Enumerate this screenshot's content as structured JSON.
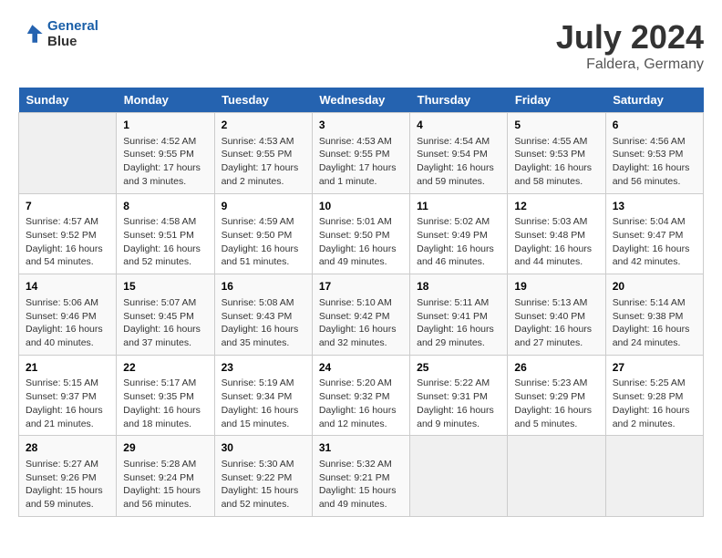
{
  "header": {
    "logo_line1": "General",
    "logo_line2": "Blue",
    "title": "July 2024",
    "subtitle": "Faldera, Germany"
  },
  "days_of_week": [
    "Sunday",
    "Monday",
    "Tuesday",
    "Wednesday",
    "Thursday",
    "Friday",
    "Saturday"
  ],
  "weeks": [
    [
      {
        "day": "",
        "info": ""
      },
      {
        "day": "1",
        "info": "Sunrise: 4:52 AM\nSunset: 9:55 PM\nDaylight: 17 hours\nand 3 minutes."
      },
      {
        "day": "2",
        "info": "Sunrise: 4:53 AM\nSunset: 9:55 PM\nDaylight: 17 hours\nand 2 minutes."
      },
      {
        "day": "3",
        "info": "Sunrise: 4:53 AM\nSunset: 9:55 PM\nDaylight: 17 hours\nand 1 minute."
      },
      {
        "day": "4",
        "info": "Sunrise: 4:54 AM\nSunset: 9:54 PM\nDaylight: 16 hours\nand 59 minutes."
      },
      {
        "day": "5",
        "info": "Sunrise: 4:55 AM\nSunset: 9:53 PM\nDaylight: 16 hours\nand 58 minutes."
      },
      {
        "day": "6",
        "info": "Sunrise: 4:56 AM\nSunset: 9:53 PM\nDaylight: 16 hours\nand 56 minutes."
      }
    ],
    [
      {
        "day": "7",
        "info": "Sunrise: 4:57 AM\nSunset: 9:52 PM\nDaylight: 16 hours\nand 54 minutes."
      },
      {
        "day": "8",
        "info": "Sunrise: 4:58 AM\nSunset: 9:51 PM\nDaylight: 16 hours\nand 52 minutes."
      },
      {
        "day": "9",
        "info": "Sunrise: 4:59 AM\nSunset: 9:50 PM\nDaylight: 16 hours\nand 51 minutes."
      },
      {
        "day": "10",
        "info": "Sunrise: 5:01 AM\nSunset: 9:50 PM\nDaylight: 16 hours\nand 49 minutes."
      },
      {
        "day": "11",
        "info": "Sunrise: 5:02 AM\nSunset: 9:49 PM\nDaylight: 16 hours\nand 46 minutes."
      },
      {
        "day": "12",
        "info": "Sunrise: 5:03 AM\nSunset: 9:48 PM\nDaylight: 16 hours\nand 44 minutes."
      },
      {
        "day": "13",
        "info": "Sunrise: 5:04 AM\nSunset: 9:47 PM\nDaylight: 16 hours\nand 42 minutes."
      }
    ],
    [
      {
        "day": "14",
        "info": "Sunrise: 5:06 AM\nSunset: 9:46 PM\nDaylight: 16 hours\nand 40 minutes."
      },
      {
        "day": "15",
        "info": "Sunrise: 5:07 AM\nSunset: 9:45 PM\nDaylight: 16 hours\nand 37 minutes."
      },
      {
        "day": "16",
        "info": "Sunrise: 5:08 AM\nSunset: 9:43 PM\nDaylight: 16 hours\nand 35 minutes."
      },
      {
        "day": "17",
        "info": "Sunrise: 5:10 AM\nSunset: 9:42 PM\nDaylight: 16 hours\nand 32 minutes."
      },
      {
        "day": "18",
        "info": "Sunrise: 5:11 AM\nSunset: 9:41 PM\nDaylight: 16 hours\nand 29 minutes."
      },
      {
        "day": "19",
        "info": "Sunrise: 5:13 AM\nSunset: 9:40 PM\nDaylight: 16 hours\nand 27 minutes."
      },
      {
        "day": "20",
        "info": "Sunrise: 5:14 AM\nSunset: 9:38 PM\nDaylight: 16 hours\nand 24 minutes."
      }
    ],
    [
      {
        "day": "21",
        "info": "Sunrise: 5:15 AM\nSunset: 9:37 PM\nDaylight: 16 hours\nand 21 minutes."
      },
      {
        "day": "22",
        "info": "Sunrise: 5:17 AM\nSunset: 9:35 PM\nDaylight: 16 hours\nand 18 minutes."
      },
      {
        "day": "23",
        "info": "Sunrise: 5:19 AM\nSunset: 9:34 PM\nDaylight: 16 hours\nand 15 minutes."
      },
      {
        "day": "24",
        "info": "Sunrise: 5:20 AM\nSunset: 9:32 PM\nDaylight: 16 hours\nand 12 minutes."
      },
      {
        "day": "25",
        "info": "Sunrise: 5:22 AM\nSunset: 9:31 PM\nDaylight: 16 hours\nand 9 minutes."
      },
      {
        "day": "26",
        "info": "Sunrise: 5:23 AM\nSunset: 9:29 PM\nDaylight: 16 hours\nand 5 minutes."
      },
      {
        "day": "27",
        "info": "Sunrise: 5:25 AM\nSunset: 9:28 PM\nDaylight: 16 hours\nand 2 minutes."
      }
    ],
    [
      {
        "day": "28",
        "info": "Sunrise: 5:27 AM\nSunset: 9:26 PM\nDaylight: 15 hours\nand 59 minutes."
      },
      {
        "day": "29",
        "info": "Sunrise: 5:28 AM\nSunset: 9:24 PM\nDaylight: 15 hours\nand 56 minutes."
      },
      {
        "day": "30",
        "info": "Sunrise: 5:30 AM\nSunset: 9:22 PM\nDaylight: 15 hours\nand 52 minutes."
      },
      {
        "day": "31",
        "info": "Sunrise: 5:32 AM\nSunset: 9:21 PM\nDaylight: 15 hours\nand 49 minutes."
      },
      {
        "day": "",
        "info": ""
      },
      {
        "day": "",
        "info": ""
      },
      {
        "day": "",
        "info": ""
      }
    ]
  ]
}
